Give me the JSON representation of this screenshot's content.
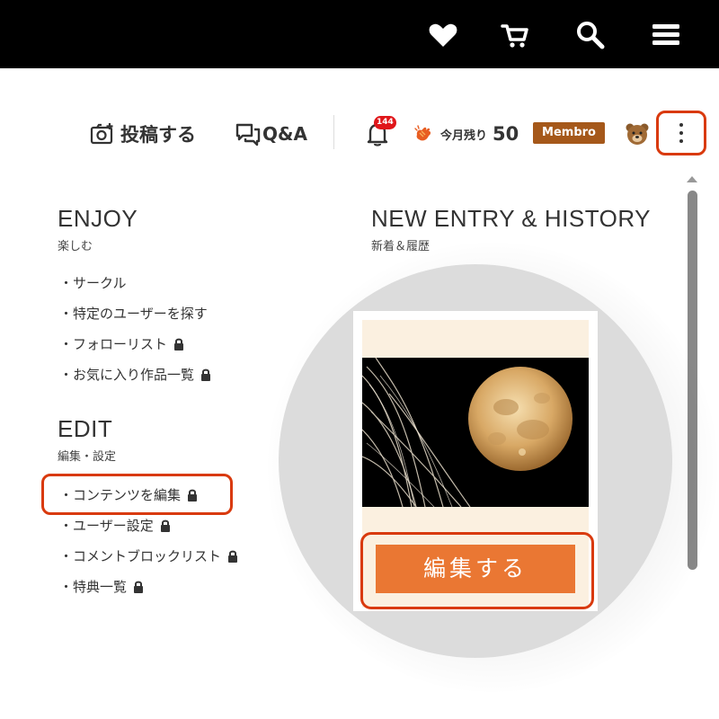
{
  "topbar": {
    "icons": [
      "heart-icon",
      "cart-icon",
      "search-icon",
      "hamburger-menu-icon"
    ]
  },
  "header": {
    "post_label": "投稿する",
    "qa_label": "Q&A",
    "notification_count": "144",
    "points_label": "今月残り",
    "points_value": "50",
    "membership_badge": "Membro"
  },
  "menu": {
    "enjoy": {
      "title": "ENJOY",
      "subtitle": "楽しむ",
      "items": [
        {
          "label": "・サークル",
          "locked": false
        },
        {
          "label": "・特定のユーザーを探す",
          "locked": false
        },
        {
          "label": "・フォローリスト",
          "locked": true
        },
        {
          "label": "・お気に入り作品一覧",
          "locked": true
        }
      ]
    },
    "edit": {
      "title": "EDIT",
      "subtitle": "編集・設定",
      "items": [
        {
          "label": "・コンテンツを編集",
          "locked": true
        },
        {
          "label": "・ユーザー設定",
          "locked": true
        },
        {
          "label": "・コメントブロックリスト",
          "locked": true
        },
        {
          "label": "・特典一覧",
          "locked": true
        }
      ]
    }
  },
  "entry": {
    "title": "NEW ENTRY & HISTORY",
    "subtitle": "新着＆履歴",
    "edit_button": "編集する"
  },
  "colors": {
    "accent": "#ea7733",
    "highlight": "#d93a0e",
    "badge": "#a5581a",
    "notification": "#e0161a"
  }
}
